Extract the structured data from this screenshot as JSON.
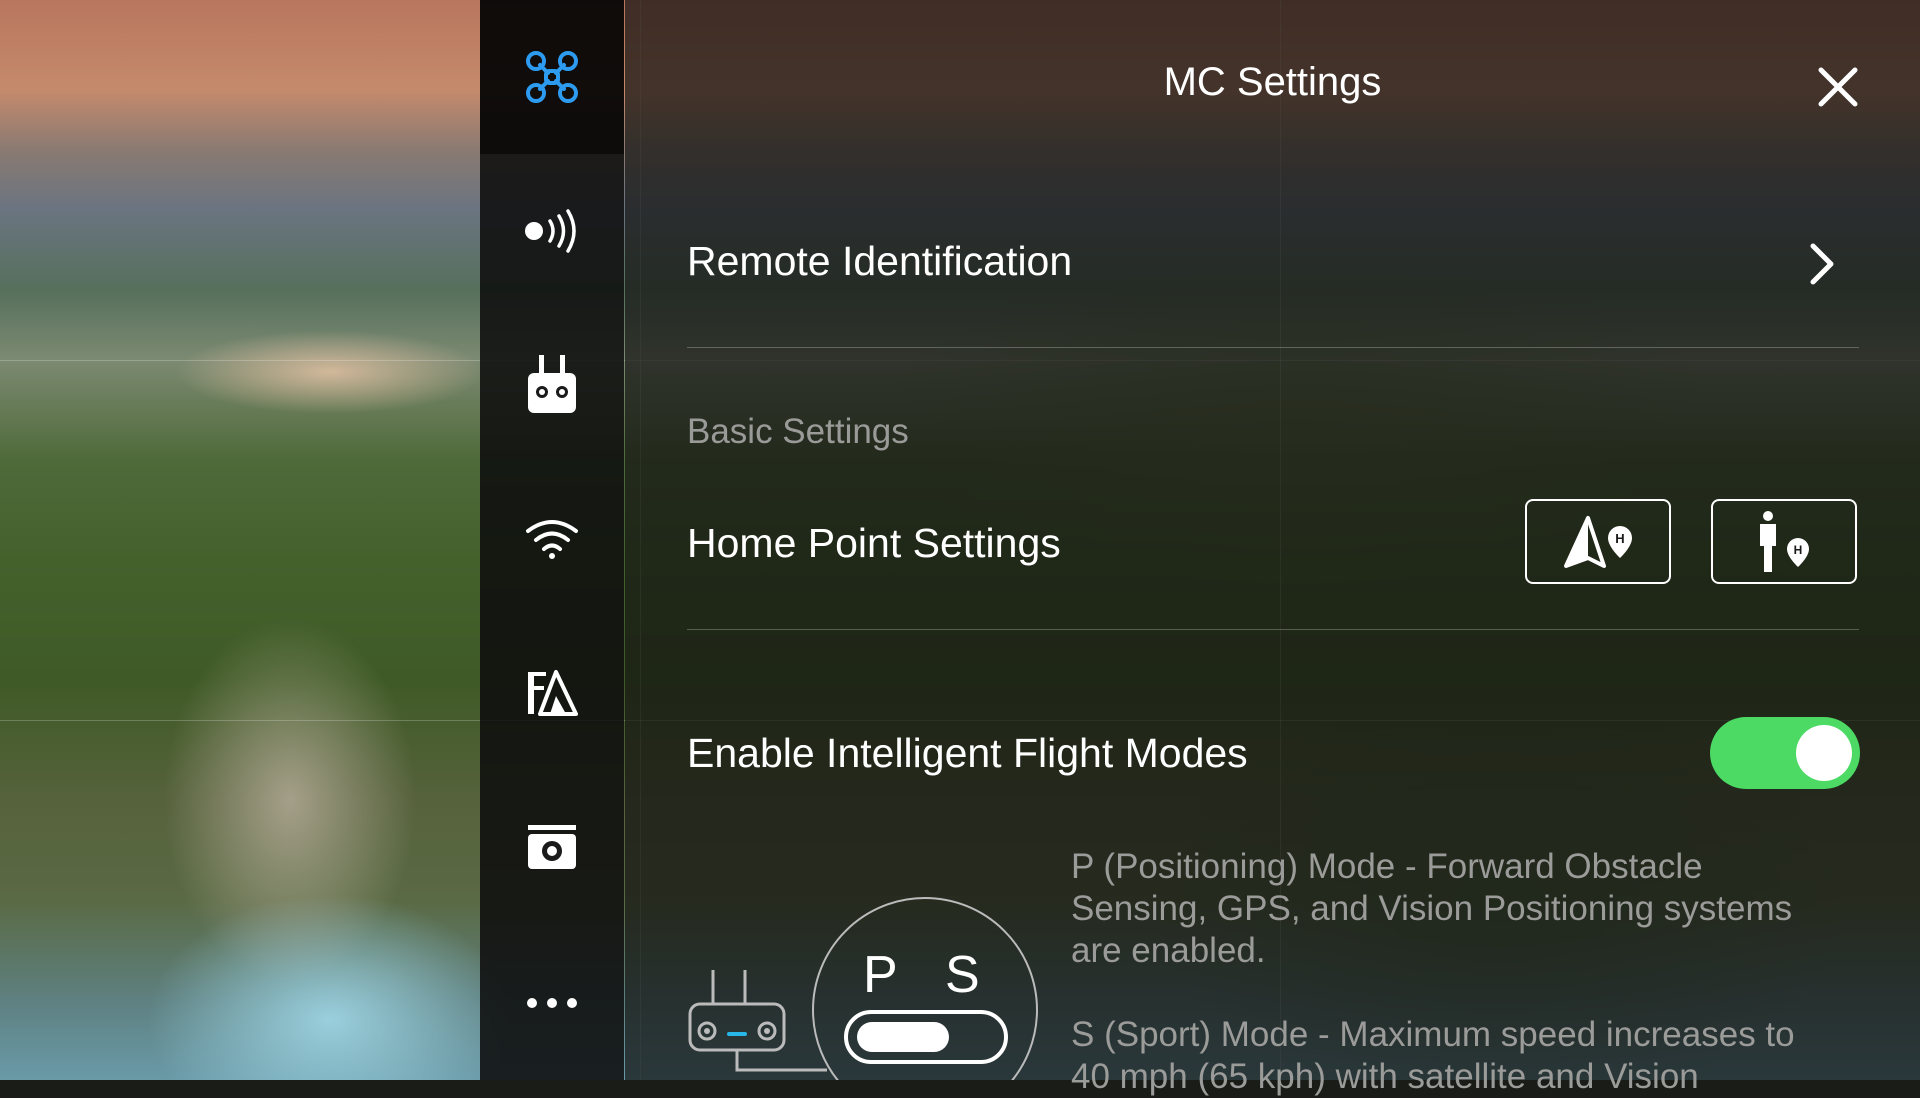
{
  "panel": {
    "title": "MC Settings",
    "remote_id_label": "Remote Identification",
    "basic_settings_label": "Basic Settings",
    "home_point_label": "Home Point Settings",
    "intelligent_modes_label": "Enable Intelligent Flight Modes",
    "intelligent_modes_enabled": true,
    "mode_letters": {
      "p": "P",
      "s": "S"
    },
    "desc_p": "P (Positioning) Mode - Forward Obstacle Sensing, GPS, and Vision Positioning systems are enabled.",
    "desc_s": "S (Sport) Mode - Maximum speed increases to 40 mph (65 kph) with satellite and Vision"
  },
  "sidebar": {
    "items": [
      {
        "icon": "aircraft-icon",
        "active": true
      },
      {
        "icon": "sensor-signal-icon",
        "active": false
      },
      {
        "icon": "remote-controller-icon",
        "active": false
      },
      {
        "icon": "wifi-icon",
        "active": false
      },
      {
        "icon": "battery-icon",
        "active": false
      },
      {
        "icon": "camera-icon",
        "active": false
      },
      {
        "icon": "more-icon",
        "active": false
      }
    ]
  },
  "colors": {
    "accent_blue": "#2d9bf0",
    "toggle_on": "#4cd964",
    "mode_indicator": "#29b6e8"
  }
}
